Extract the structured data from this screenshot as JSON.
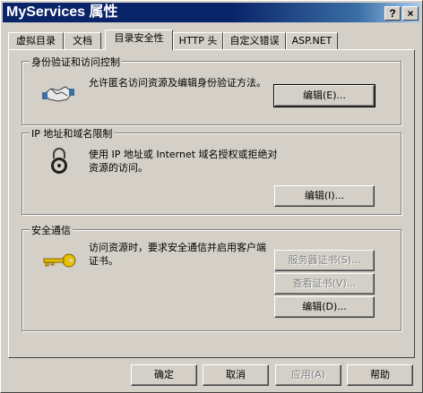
{
  "window": {
    "title": "MyServices 属性"
  },
  "title_buttons": {
    "help": "?",
    "close": "×"
  },
  "tabs": [
    {
      "label": "虚拟目录"
    },
    {
      "label": "文档"
    },
    {
      "label": "目录安全性"
    },
    {
      "label": "HTTP 头"
    },
    {
      "label": "自定义错误"
    },
    {
      "label": "ASP.NET"
    }
  ],
  "groups": {
    "auth": {
      "title": "身份验证和访问控制",
      "description": "允许匿名访问资源及编辑身份验证方法。",
      "edit_button": "编辑(E)..."
    },
    "ip": {
      "title": "IP 地址和域名限制",
      "description": "使用 IP 地址或 Internet 域名授权或拒绝对资源的访问。",
      "edit_button": "编辑(I)..."
    },
    "secure": {
      "title": "安全通信",
      "description": "访问资源时，要求安全通信并启用客户端证书。",
      "server_cert_button": "服务器证书(S)...",
      "view_cert_button": "查看证书(V)...",
      "edit_button": "编辑(D)..."
    }
  },
  "footer": {
    "ok": "确定",
    "cancel": "取消",
    "apply": "应用(A)",
    "help": "帮助"
  }
}
